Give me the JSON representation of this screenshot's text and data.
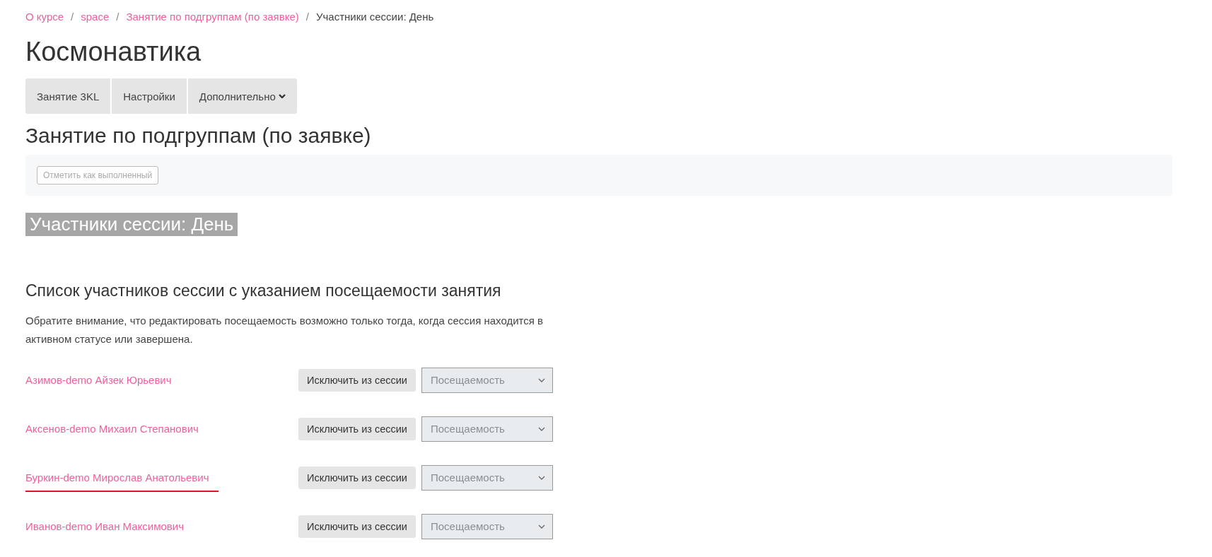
{
  "breadcrumb_separator": "/",
  "breadcrumb": [
    {
      "label": "О курсе",
      "link": true
    },
    {
      "label": "space",
      "link": true
    },
    {
      "label": "Занятие по подгруппам (по заявке)",
      "link": true
    },
    {
      "label": "Участники сессии: День",
      "link": false
    }
  ],
  "course_title": "Космонавтика",
  "tabs": [
    {
      "label": "Занятие 3KL",
      "dropdown": false
    },
    {
      "label": "Настройки",
      "dropdown": false
    },
    {
      "label": "Дополнительно",
      "dropdown": true
    }
  ],
  "activity_title": "Занятие по подгруппам (по заявке)",
  "completion_button": {
    "label": "Отметить как выполненный",
    "disabled": true
  },
  "session_title": "Участники сессии: День",
  "list_title": "Список участников сессии с указанием посещаемости занятия",
  "notice": "Обратите внимание, что редактировать посещаемость возможно только тогда, когда сессия находится в активном статусе или завершена.",
  "participants": [
    {
      "name": "Азимов-demo Айзек Юрьевич",
      "action": "Исключить из сессии",
      "attendance_placeholder": "Посещаемость",
      "underlined": false
    },
    {
      "name": "Аксенов-demo Михаил Степанович",
      "action": "Исключить из сессии",
      "attendance_placeholder": "Посещаемость",
      "underlined": false
    },
    {
      "name": "Буркин-demo Мирослав Анатольевич",
      "action": "Исключить из сессии",
      "attendance_placeholder": "Посещаемость",
      "underlined": true
    },
    {
      "name": "Иванов-demo Иван Максимович",
      "action": "Исключить из сессии",
      "attendance_placeholder": "Посещаемость",
      "underlined": false
    }
  ]
}
